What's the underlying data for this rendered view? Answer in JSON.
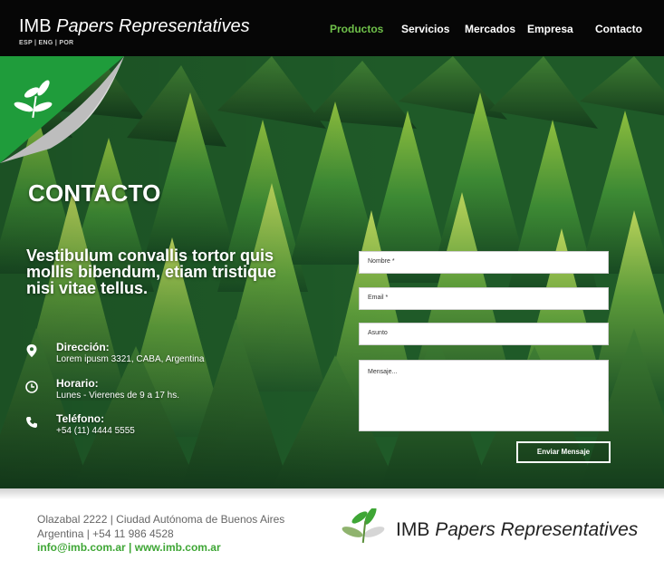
{
  "header": {
    "brand_imb": "IMB",
    "brand_name": "Papers Representatives",
    "languages": "ESP | ENG | POR",
    "nav": [
      "Productos",
      "Servicios",
      "Mercados",
      "Empresa",
      "Contacto"
    ],
    "active_nav": "Productos"
  },
  "hero": {
    "title": "CONTACTO",
    "lead": "Vestibulum convallis tortor quis mollis bibendum, etiam tristique nisi vitae tellus.",
    "info": [
      {
        "label": "Dirección:",
        "value": "Lorem ipusm 3321, CABA, Argentina",
        "icon": "location-pin-icon"
      },
      {
        "label": "Horario:",
        "value": "Lunes - Vierenes de 9 a 17 hs.",
        "icon": "clock-icon"
      },
      {
        "label": "Teléfono:",
        "value": "+54 (11) 4444 5555",
        "icon": "phone-icon"
      }
    ],
    "form": {
      "nombre_placeholder": "Nombre *",
      "email_placeholder": "Email *",
      "asunto_placeholder": "Asunto",
      "mensaje_placeholder": "Mensaje...",
      "send_label": "Enviar Mensaje"
    }
  },
  "footer": {
    "address_line": "Olazabal  2222 | Ciudad Autónoma de Buenos Aires",
    "country_phone": "Argentina | +54 11 986 4528",
    "contact_links": "info@imb.com.ar | www.imb.com.ar",
    "brand_imb": "IMB",
    "brand_name": "Papers Representatives"
  },
  "colors": {
    "accent_green": "#6fc04a",
    "footer_green": "#3ea635",
    "header_bg": "#060606",
    "corner_green": "#1f9c3b"
  }
}
